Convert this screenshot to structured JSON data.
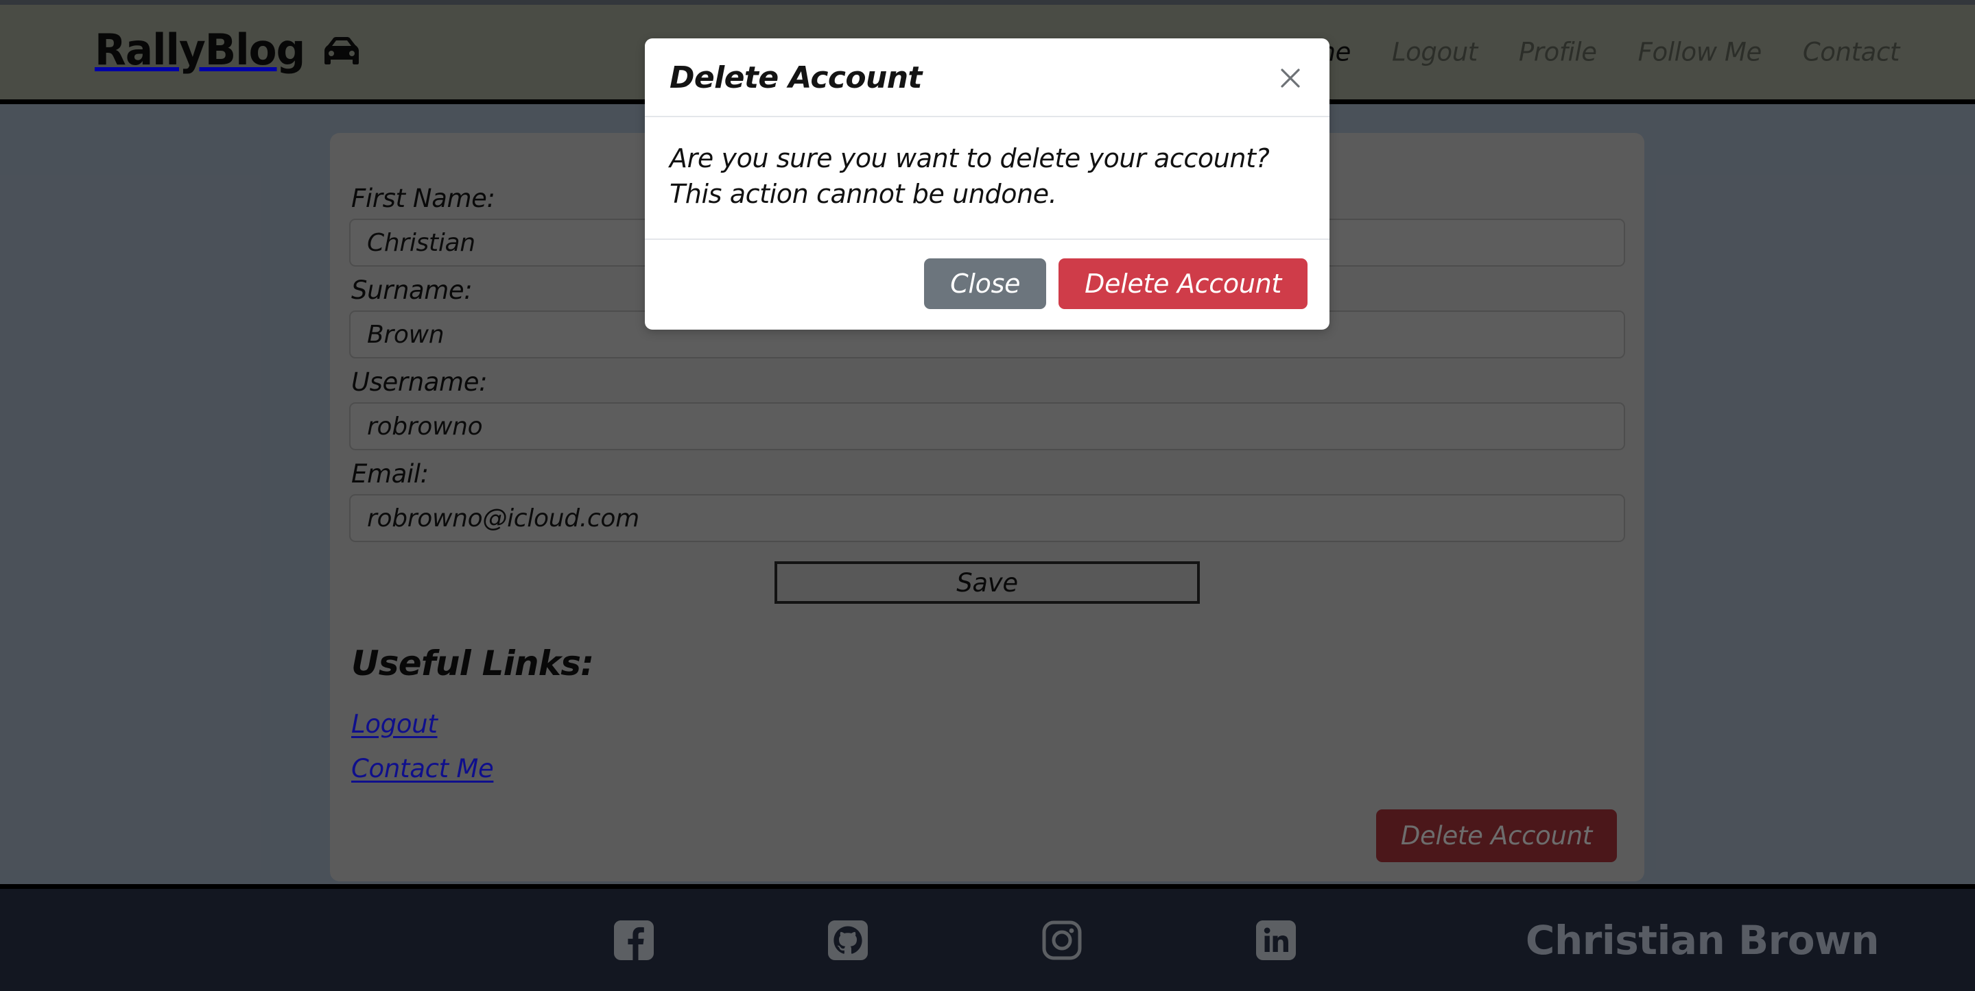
{
  "header": {
    "brand": "RallyBlog",
    "brand_icon": "car-icon",
    "nav": [
      {
        "label": "Home",
        "active": true
      },
      {
        "label": "Logout",
        "active": false
      },
      {
        "label": "Profile",
        "active": false
      },
      {
        "label": "Follow Me",
        "active": false
      },
      {
        "label": "Contact",
        "active": false
      }
    ]
  },
  "profile_form": {
    "fields": [
      {
        "label": "First Name:",
        "value": "Christian",
        "name": "first-name"
      },
      {
        "label": "Surname:",
        "value": "Brown",
        "name": "surname"
      },
      {
        "label": "Username:",
        "value": "robrowno",
        "name": "username"
      },
      {
        "label": "Email:",
        "value": "robrowno@icloud.com",
        "name": "email"
      }
    ],
    "save_label": "Save",
    "useful_links_title": "Useful Links:",
    "useful_links": [
      {
        "label": "Logout"
      },
      {
        "label": "Contact Me"
      }
    ],
    "delete_account_label": "Delete Account"
  },
  "modal": {
    "title": "Delete Account",
    "close_icon": "close-icon",
    "body_text": "Are you sure you want to delete your account? This action cannot be undone.",
    "close_label": "Close",
    "confirm_label": "Delete Account"
  },
  "footer": {
    "social": [
      {
        "name": "facebook-icon"
      },
      {
        "name": "github-icon"
      },
      {
        "name": "instagram-icon"
      },
      {
        "name": "linkedin-icon"
      }
    ],
    "name": "Christian Brown"
  },
  "colors": {
    "navbar_bg": "#6a6d63",
    "body_bg": "#6b7480",
    "card_bg": "#838383",
    "footer_bg": "#1c2230",
    "link_blue": "#1616c9",
    "danger": "#cf3c49",
    "secondary": "#6c757d",
    "page_danger_dim": "#6c2226"
  }
}
